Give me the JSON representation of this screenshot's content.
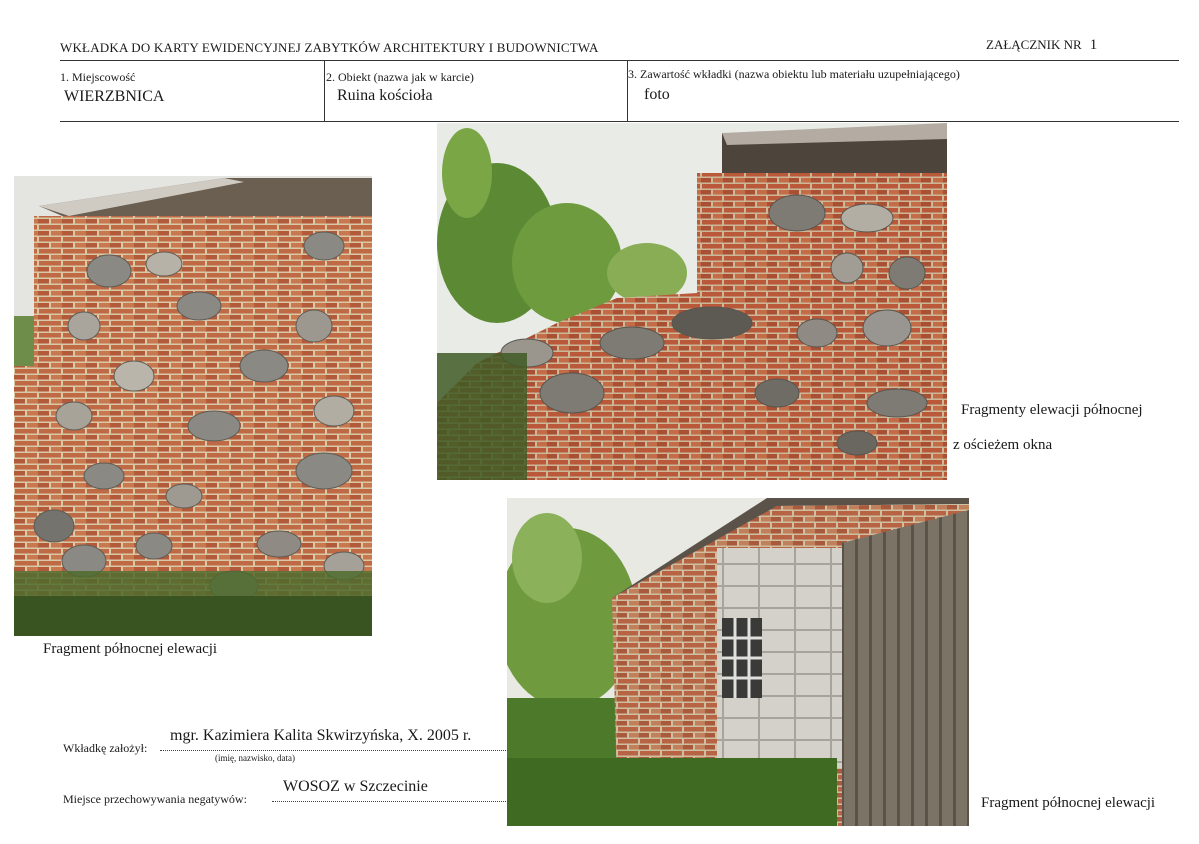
{
  "header": {
    "title": "WKŁADKA DO KARTY EWIDENCYJNEJ ZABYTKÓW ARCHITEKTURY I BUDOWNICTWA",
    "annex_label": "ZAŁĄCZNIK NR",
    "annex_number": "1"
  },
  "fields": [
    {
      "label": "1. Miejscowość",
      "value": "WIERZBNICA"
    },
    {
      "label": "2. Obiekt (nazwa jak w karcie)",
      "value": "Ruina kościoła"
    },
    {
      "label": "3. Zawartość wkładki (nazwa obiektu lub materiału uzupełniającego)",
      "value": "foto"
    }
  ],
  "captions": {
    "left_photo": "Fragment północnej elewacji",
    "top_photo_line1": "Fragmenty elewacji północnej",
    "top_photo_line2": "z ościeżem okna",
    "bottom_photo": "Fragment północnej elewacji"
  },
  "footer": {
    "author_label": "Wkładkę założył:",
    "author_value": "mgr. Kazimiera Kalita Skwirzyńska, X. 2005 r.",
    "author_hint": "(imię, nazwisko, data)",
    "storage_label": "Miejsce przechowywania negatywów:",
    "storage_value": "WOSOZ w Szczecinie"
  },
  "colors": {
    "brick": "#b85a3a",
    "mortar": "#d8c9a8",
    "stone": "#7d7a74",
    "foliage": "#4f7a2e",
    "sky": "#e6e8e4"
  }
}
